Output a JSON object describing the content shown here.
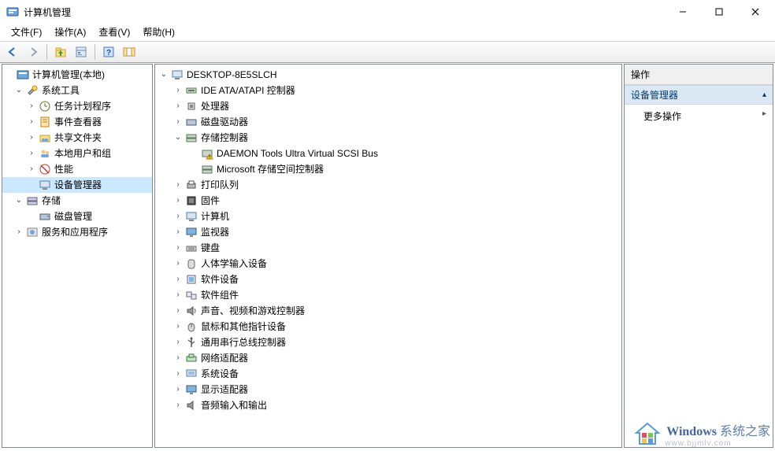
{
  "window": {
    "title": "计算机管理",
    "buttons": {
      "min": "–",
      "max": "☐",
      "close": "✕"
    }
  },
  "menus": {
    "file": "文件(F)",
    "action": "操作(A)",
    "view": "查看(V)",
    "help": "帮助(H)"
  },
  "left_tree": {
    "root": "计算机管理(本地)",
    "system_tools": {
      "label": "系统工具",
      "task_scheduler": "任务计划程序",
      "event_viewer": "事件查看器",
      "shared_folders": "共享文件夹",
      "local_users": "本地用户和组",
      "performance": "性能",
      "device_manager": "设备管理器"
    },
    "storage": {
      "label": "存储",
      "disk_mgmt": "磁盘管理"
    },
    "services_apps": "服务和应用程序"
  },
  "device_tree": {
    "root": "DESKTOP-8E5SLCH",
    "ide": "IDE ATA/ATAPI 控制器",
    "cpu": "处理器",
    "disk": "磁盘驱动器",
    "storage": {
      "label": "存储控制器",
      "daemon": "DAEMON Tools Ultra Virtual SCSI Bus",
      "msspace": "Microsoft 存储空间控制器"
    },
    "printq": "打印队列",
    "firmware": "固件",
    "computer": "计算机",
    "monitor": "监视器",
    "keyboard": "键盘",
    "hid": "人体学输入设备",
    "softdev": "软件设备",
    "softcomp": "软件组件",
    "sound": "声音、视频和游戏控制器",
    "mouse": "鼠标和其他指针设备",
    "usb": "通用串行总线控制器",
    "net": "网络适配器",
    "sysdev": "系统设备",
    "display": "显示适配器",
    "audioio": "音频输入和输出"
  },
  "actions": {
    "header": "操作",
    "band": "设备管理器",
    "more": "更多操作"
  },
  "watermark": {
    "brand1": "Windows",
    "brand2": " 系统之家",
    "url": "www.bjjmlv.com"
  }
}
